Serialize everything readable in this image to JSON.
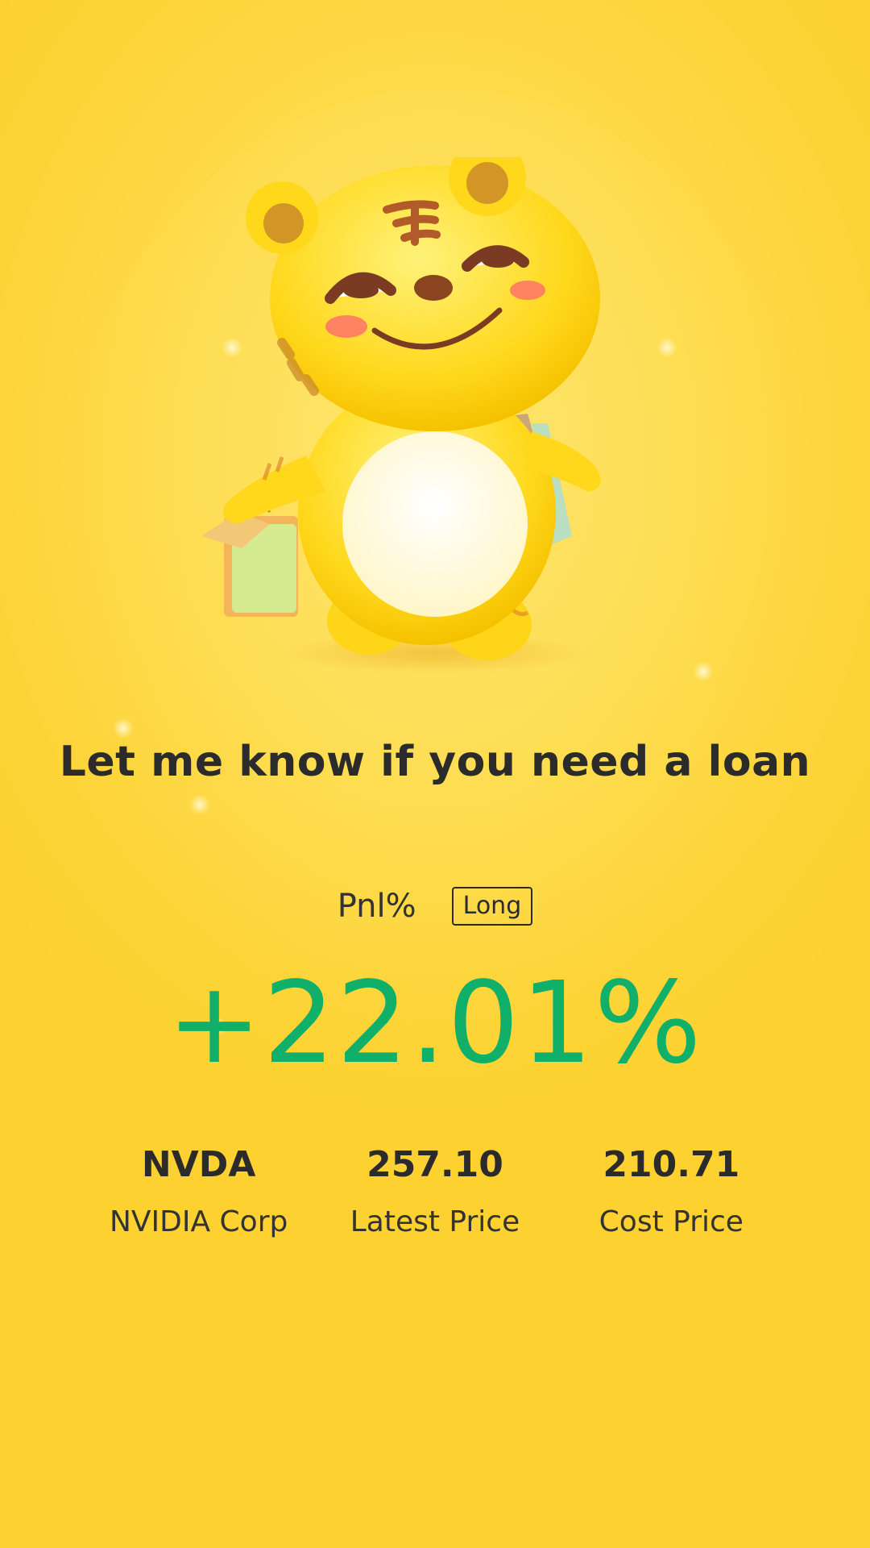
{
  "headline": "Let me know if you need a loan",
  "pnl": {
    "label": "Pnl%",
    "direction": "Long",
    "value": "+22.01%"
  },
  "position": {
    "symbol": "NVDA",
    "company": "NVIDIA Corp",
    "latest_price": "257.10",
    "latest_price_label": "Latest Price",
    "cost_price": "210.71",
    "cost_price_label": "Cost Price"
  },
  "colors": {
    "background": "#fdd437",
    "positive": "#10b06a",
    "text": "#2b2b2b"
  },
  "icons": {
    "mascot": "tiger-mascot-with-shopping-bags"
  }
}
